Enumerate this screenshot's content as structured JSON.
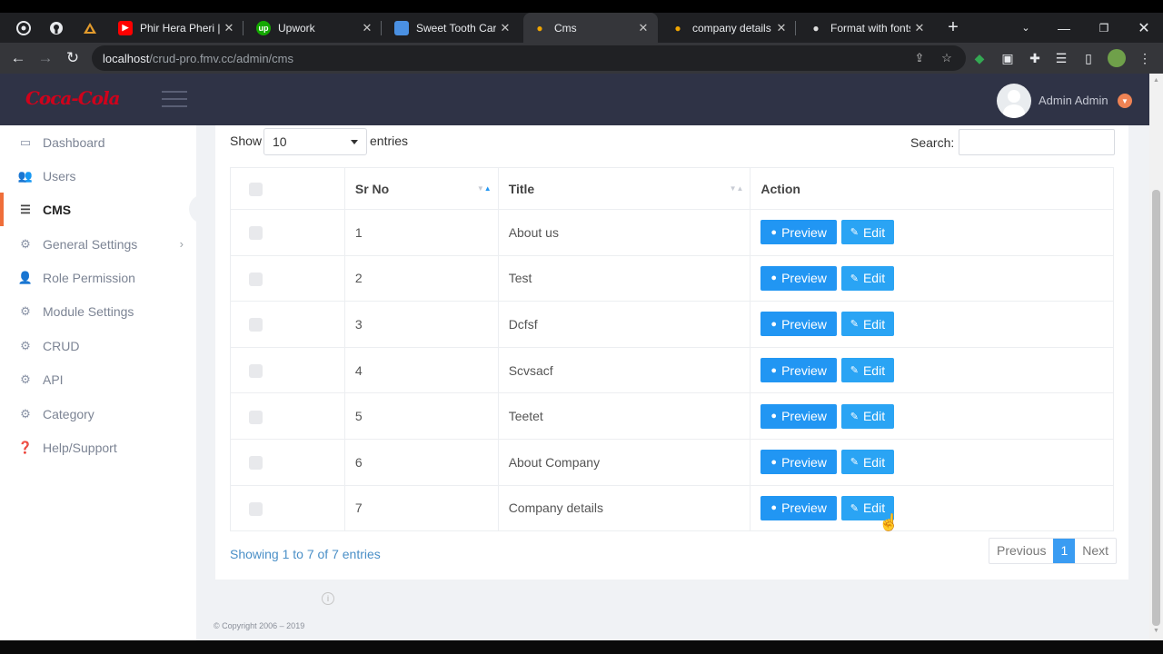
{
  "browser": {
    "tabs": [
      {
        "title": "Phir Hera Pheri | F…",
        "favicon_color": "#ff0000"
      },
      {
        "title": "Upwork",
        "favicon_color": "#14a800"
      },
      {
        "title": "Sweet Tooth Care",
        "favicon_color": "#4a90e2"
      },
      {
        "title": "Cms",
        "favicon_color": "#f0a500",
        "active": true
      },
      {
        "title": "company details",
        "favicon_color": "#f0a500"
      },
      {
        "title": "Format with fonts",
        "favicon_color": "#dddddd"
      }
    ],
    "url_host": "localhost",
    "url_path": "/crud-pro.fmv.cc/admin/cms"
  },
  "header": {
    "logo": "Coca-Cola",
    "user_name": "Admin Admin"
  },
  "sidebar": {
    "items": [
      {
        "label": "Dashboard",
        "icon": "monitor-icon"
      },
      {
        "label": "Users",
        "icon": "users-icon"
      },
      {
        "label": "CMS",
        "icon": "list-icon",
        "active": true
      },
      {
        "label": "General Settings",
        "icon": "gears-icon",
        "has_submenu": true
      },
      {
        "label": "Role Permission",
        "icon": "user-key-icon"
      },
      {
        "label": "Module Settings",
        "icon": "gear-icon"
      },
      {
        "label": "CRUD",
        "icon": "gear-icon"
      },
      {
        "label": "API",
        "icon": "gear-icon"
      },
      {
        "label": "Category",
        "icon": "gear-icon"
      },
      {
        "label": "Help/Support",
        "icon": "help-icon"
      }
    ]
  },
  "table_controls": {
    "show_label": "Show",
    "page_length": "10",
    "entries_label": "entries",
    "search_label": "Search:",
    "search_value": ""
  },
  "table": {
    "headers": [
      "",
      "Sr No",
      "Title",
      "Action"
    ],
    "rows": [
      {
        "sr": "1",
        "title": "About us"
      },
      {
        "sr": "2",
        "title": "Test"
      },
      {
        "sr": "3",
        "title": "Dcfsf"
      },
      {
        "sr": "4",
        "title": "Scvsacf"
      },
      {
        "sr": "5",
        "title": "Teetet"
      },
      {
        "sr": "6",
        "title": "About Company"
      },
      {
        "sr": "7",
        "title": "Company details"
      }
    ],
    "preview_label": "Preview",
    "edit_label": "Edit"
  },
  "footer_info": "Showing 1 to 7 of 7 entries",
  "pagination": {
    "previous": "Previous",
    "current": "1",
    "next": "Next"
  },
  "copyright": "© Copyright 2006 – 2019",
  "colors": {
    "header_bg": "#2f3346",
    "accent": "#ef6e3a",
    "button": "#2196f3"
  }
}
